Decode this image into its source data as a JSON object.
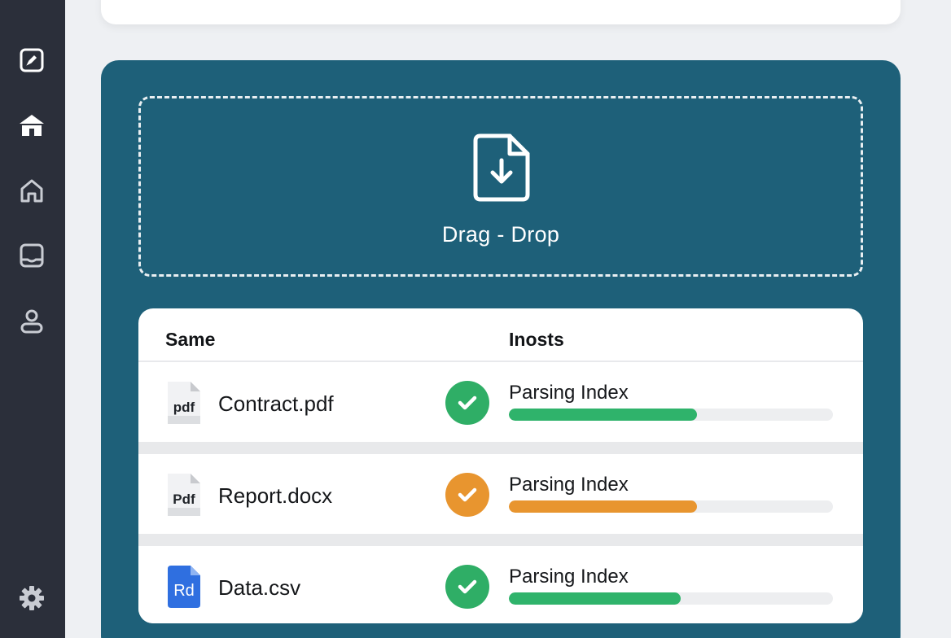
{
  "sidebar": {
    "items": [
      {
        "icon": "document-edit-icon"
      },
      {
        "icon": "home-filled-icon"
      },
      {
        "icon": "home-outline-icon"
      },
      {
        "icon": "inbox-icon"
      },
      {
        "icon": "user-icon"
      }
    ],
    "bottom": {
      "icon": "gear-icon"
    }
  },
  "upload": {
    "icon": "file-download-icon",
    "label": "Drag - Drop"
  },
  "table": {
    "headers": [
      "Same",
      "Inosts"
    ],
    "rows": [
      {
        "file_tag": "pdf",
        "file_name": "Contract.pdf",
        "status": "complete",
        "status_color": "#2fae66",
        "progress_label": "Parsing Index",
        "progress": 0.58,
        "progress_color": "#2fb36b"
      },
      {
        "file_tag": "Pdf",
        "file_name": "Report.docx",
        "status": "warning",
        "status_color": "#e8952f",
        "progress_label": "Parsing Index",
        "progress": 0.58,
        "progress_color": "#e8952f"
      },
      {
        "file_tag": "Rd",
        "file_name": "Data.csv",
        "status": "complete",
        "status_color": "#2fae66",
        "progress_label": "Parsing Index",
        "progress": 0.53,
        "progress_color": "#2fb36b"
      }
    ]
  },
  "colors": {
    "sidebar_bg": "#2b2f3a",
    "panel_bg": "#1e6079",
    "page_bg": "#eef0f3"
  }
}
